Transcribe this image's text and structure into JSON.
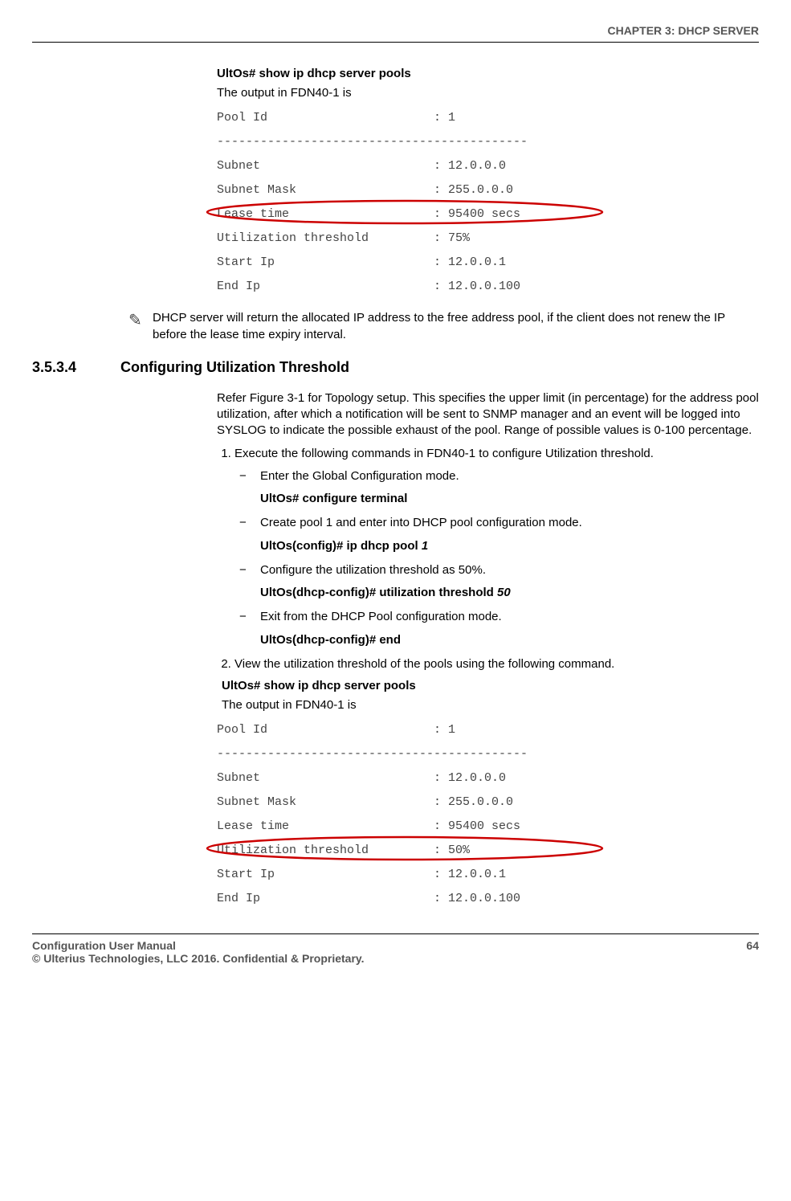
{
  "header": "CHAPTER 3: DHCP SERVER",
  "block1": {
    "cmd": "UltOs# show ip dhcp server pools",
    "intro": "The output in FDN40-1 is",
    "mono": "Pool Id                       : 1\n-------------------------------------------\nSubnet                        : 12.0.0.0\nSubnet Mask                   : 255.0.0.0\nLease time                    : 95400 secs\nUtilization threshold         : 75%\nStart Ip                      : 12.0.0.1\nEnd Ip                        : 12.0.0.100"
  },
  "note": "DHCP server will return the allocated IP address to the free address pool, if the client does not renew the IP before the lease time expiry interval.",
  "section": {
    "num": "3.5.3.4",
    "title": "Configuring Utilization Threshold",
    "intro": "Refer Figure 3-1 for Topology setup. This specifies the upper limit (in percentage) for the address pool utilization, after which a notification will be sent to SNMP manager and an event will be logged into SYSLOG to indicate the possible exhaust of the pool. Range of possible values is 0-100 percentage.",
    "step1": "Execute the following commands in FDN40-1 to configure Utilization threshold.",
    "sub1": "Enter the Global Configuration mode.",
    "cmd1": "UltOs# configure terminal",
    "sub2": "Create pool 1 and enter into DHCP pool configuration mode.",
    "cmd2a": "UltOs(config)# ip dhcp pool ",
    "cmd2b": "1",
    "sub3": "Configure the utilization threshold as 50%.",
    "cmd3a": "UltOs(dhcp-config)# utilization threshold ",
    "cmd3b": "50",
    "sub4": "Exit from the DHCP Pool configuration mode.",
    "cmd4": "UltOs(dhcp-config)# end",
    "step2": "View the utilization threshold of the pools using the following command."
  },
  "block2": {
    "cmd": "UltOs# show ip dhcp server pools",
    "intro": "The output in FDN40-1 is",
    "mono": "Pool Id                       : 1\n-------------------------------------------\nSubnet                        : 12.0.0.0\nSubnet Mask                   : 255.0.0.0\nLease time                    : 95400 secs\nUtilization threshold         : 50%\nStart Ip                      : 12.0.0.1\nEnd Ip                        : 12.0.0.100"
  },
  "footer": {
    "left1": "Configuration User Manual",
    "left2": "© Ulterius Technologies, LLC 2016. Confidential & Proprietary.",
    "page": "64"
  }
}
